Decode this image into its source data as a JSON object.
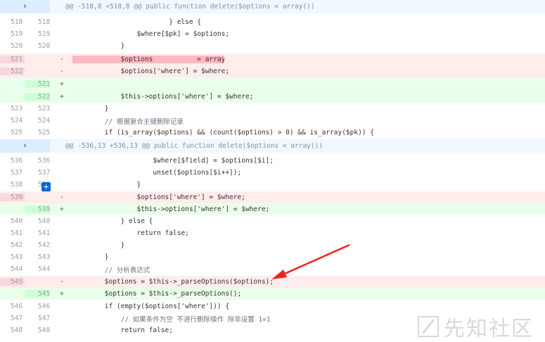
{
  "hunks": [
    {
      "header": "@@ -518,8 +518,8 @@ public function delete($options = array())"
    },
    {
      "header": "@@ -536,13 +536,13 @@ public function delete($options = array())"
    }
  ],
  "lines": [
    {
      "old": "518",
      "new": "518",
      "type": "ctx",
      "sign": "",
      "code": "            } else {"
    },
    {
      "old": "519",
      "new": "519",
      "type": "ctx",
      "sign": "",
      "code": "                $where[$pk] = $options;"
    },
    {
      "old": "520",
      "new": "520",
      "type": "ctx",
      "sign": "",
      "code": "            }"
    },
    {
      "old": "521",
      "new": "",
      "type": "del",
      "sign": "-",
      "code": "            $options           = array();"
    },
    {
      "old": "522",
      "new": "",
      "type": "del",
      "sign": "-",
      "code": "            $options['where'] = $where;"
    },
    {
      "old": "",
      "new": "521",
      "type": "add",
      "sign": "+",
      "code": ""
    },
    {
      "old": "",
      "new": "522",
      "type": "add",
      "sign": "+",
      "code": "            $this->options['where'] = $where;"
    },
    {
      "old": "523",
      "new": "523",
      "type": "ctx",
      "sign": "",
      "code": "        }"
    },
    {
      "old": "524",
      "new": "524",
      "type": "ctx",
      "sign": "",
      "code": "        // 根据复合主键删除记录"
    },
    {
      "old": "525",
      "new": "525",
      "type": "ctx",
      "sign": "",
      "code": "        if (is_array($options) && (count($options) > 0) && is_array($pk)) {"
    },
    {
      "old": "536",
      "new": "536",
      "type": "ctx",
      "sign": "",
      "code": "                    $where[$field] = $options[$i];"
    },
    {
      "old": "537",
      "new": "537",
      "type": "ctx",
      "sign": "",
      "code": "                    unset($options[$i++]);"
    },
    {
      "old": "538",
      "new": "538",
      "type": "ctx",
      "sign": "",
      "code": "                }"
    },
    {
      "old": "539",
      "new": "",
      "type": "del",
      "sign": "-",
      "code": "                $options['where'] = $where;"
    },
    {
      "old": "",
      "new": "539",
      "type": "add",
      "sign": "+",
      "code": "                $this->options['where'] = $where;"
    },
    {
      "old": "540",
      "new": "540",
      "type": "ctx",
      "sign": "",
      "code": "            } else {"
    },
    {
      "old": "541",
      "new": "541",
      "type": "ctx",
      "sign": "",
      "code": "                return false;"
    },
    {
      "old": "542",
      "new": "542",
      "type": "ctx",
      "sign": "",
      "code": "            }"
    },
    {
      "old": "543",
      "new": "543",
      "type": "ctx",
      "sign": "",
      "code": "        }"
    },
    {
      "old": "544",
      "new": "544",
      "type": "ctx",
      "sign": "",
      "code": "        // 分析表达式"
    },
    {
      "old": "545",
      "new": "",
      "type": "del",
      "sign": "-",
      "code": "        $options = $this->_parseOptions($options);"
    },
    {
      "old": "",
      "new": "545",
      "type": "add",
      "sign": "+",
      "code": "        $options = $this->_parseOptions();"
    },
    {
      "old": "546",
      "new": "546",
      "type": "ctx",
      "sign": "",
      "code": "        if (empty($options['where'])) {"
    },
    {
      "old": "547",
      "new": "547",
      "type": "ctx",
      "sign": "",
      "code": "            // 如果条件为空 不进行删除操作 除非设置 1=1"
    },
    {
      "old": "548",
      "new": "548",
      "type": "ctx",
      "sign": "",
      "code": "            return false;"
    }
  ],
  "expand_icon": "expand-icon",
  "add_comment_icon": "plus-icon",
  "watermark": "先知社区",
  "colors": {
    "deletion": "#ffecec",
    "addition": "#eaffea",
    "hunk": "#f1f8ff",
    "arrow": "#e8261c",
    "accent": "#0366d6"
  }
}
